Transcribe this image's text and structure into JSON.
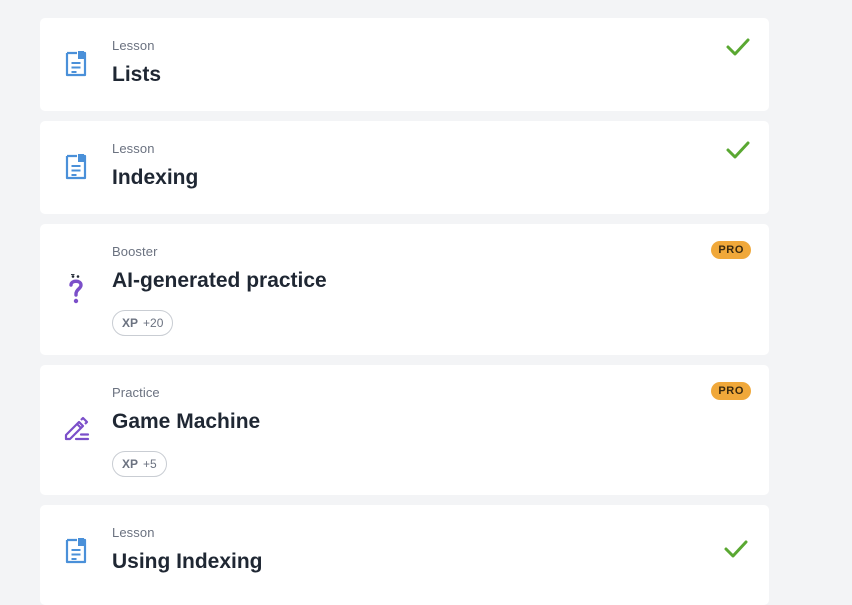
{
  "items": [
    {
      "type": "Lesson",
      "title": "Lists",
      "status": "completed",
      "icon": "lesson-doc-icon"
    },
    {
      "type": "Lesson",
      "title": "Indexing",
      "status": "completed",
      "icon": "lesson-doc-icon"
    },
    {
      "type": "Booster",
      "title": "AI-generated practice",
      "status": "pro",
      "badge": "PRO",
      "xp_label": "XP",
      "xp_value": "+20",
      "icon": "question-mark-icon"
    },
    {
      "type": "Practice",
      "title": "Game Machine",
      "status": "pro",
      "badge": "PRO",
      "xp_label": "XP",
      "xp_value": "+5",
      "icon": "pencil-edit-icon"
    },
    {
      "type": "Lesson",
      "title": "Using Indexing",
      "status": "completed",
      "icon": "lesson-doc-icon"
    }
  ],
  "colors": {
    "background": "#f3f4f6",
    "card": "#ffffff",
    "lesson_icon": "#4a90d9",
    "purple_icon": "#7b4fc9",
    "check": "#5aa832",
    "pro_badge": "#f0a83a"
  }
}
